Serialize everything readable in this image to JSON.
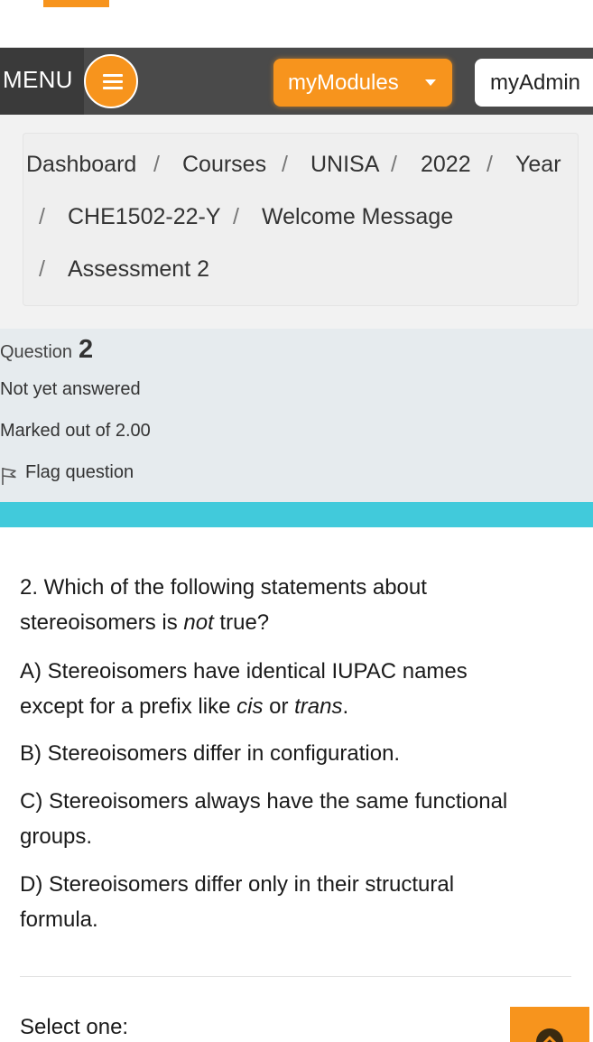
{
  "navbar": {
    "menu_label": "MENU",
    "modules_label": "myModules",
    "admin_label": "myAdmin"
  },
  "breadcrumb": {
    "items": [
      "Dashboard",
      "Courses",
      "UNISA",
      "2022",
      "Year",
      "CHE1502-22-Y",
      "Welcome Message",
      "Assessment 2"
    ],
    "separator": "/"
  },
  "question_info": {
    "word": "Question",
    "number": "2",
    "state": "Not yet answered",
    "grade": "Marked out of 2.00",
    "flag_label": "Flag question"
  },
  "question": {
    "stem_line1": "2. Which of the following statements about",
    "stem_line2_pre": "stereoisomers is ",
    "stem_line2_em": "not",
    "stem_line2_post": " true?",
    "a_line1": "A) Stereoisomers have identical IUPAC names",
    "a_line2_pre": "except for a prefix like ",
    "a_em1": "cis",
    "a_mid": " or ",
    "a_em2": "trans",
    "a_end": ".",
    "b": "B) Stereoisomers differ in configuration.",
    "c_line1": "C) Stereoisomers always have the same functional",
    "c_line2": "groups.",
    "d_line1": "D) Stereoisomers differ only in their structural",
    "d_line2": "formula."
  },
  "answer": {
    "prompt": "Select one:"
  },
  "icons": {
    "menu": "hamburger-icon",
    "modules_caret": "caret-down-icon",
    "flag": "flag-icon",
    "scroll_top": "chevron-up-icon"
  },
  "colors": {
    "accent": "#f7941d",
    "navbar": "#4a4a4a",
    "info_bg": "#e6ebee",
    "cyan_bar": "#41cadb"
  }
}
